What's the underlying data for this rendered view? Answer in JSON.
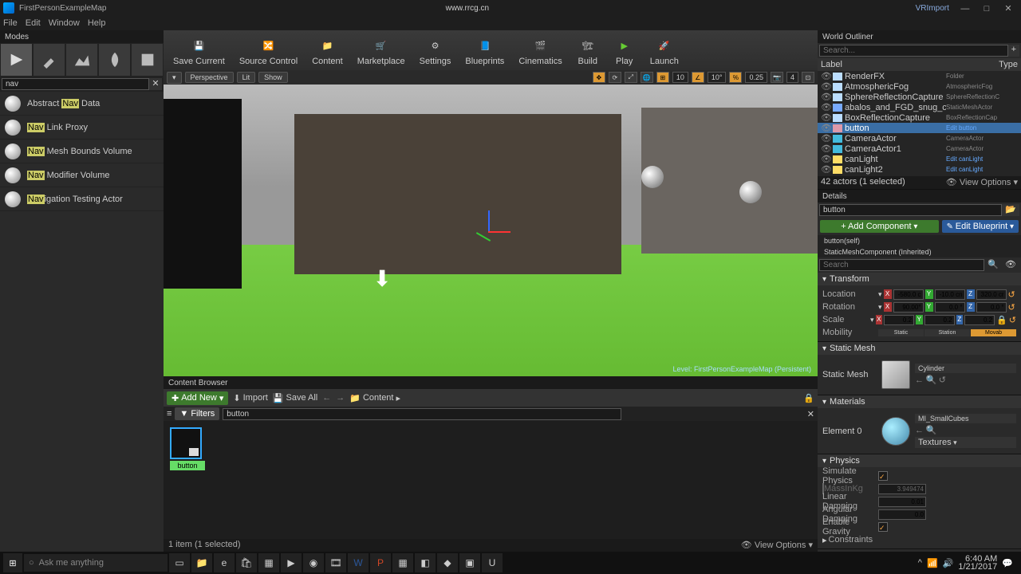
{
  "title": "FirstPersonExampleMap",
  "project": "VRImport",
  "watermark": "www.rrcg.cn",
  "menu": [
    "File",
    "Edit",
    "Window",
    "Help"
  ],
  "modes": {
    "title": "Modes",
    "search": "nav"
  },
  "place_items": [
    {
      "pre": "Abstract ",
      "hl": "Nav",
      "post": " Data"
    },
    {
      "pre": "",
      "hl": "Nav",
      "post": " Link Proxy"
    },
    {
      "pre": "",
      "hl": "Nav",
      "post": " Mesh Bounds Volume"
    },
    {
      "pre": "",
      "hl": "Nav",
      "post": " Modifier Volume"
    },
    {
      "pre": "",
      "hl": "Nav",
      "post": "igation Testing Actor"
    }
  ],
  "toolbar": [
    "Save Current",
    "Source Control",
    "Content",
    "Marketplace",
    "Settings",
    "Blueprints",
    "Cinematics",
    "Build",
    "Play",
    "Launch"
  ],
  "viewport": {
    "persp": "Perspective",
    "lit": "Lit",
    "show": "Show",
    "grid": "10",
    "angle": "10°",
    "scale": "0.25",
    "cam": "4",
    "level": "Level: FirstPersonExampleMap (Persistent)"
  },
  "content_browser": {
    "title": "Content Browser",
    "add": "Add New",
    "import": "Import",
    "save": "Save All",
    "path": "Content",
    "filters": "Filters",
    "filter": "button",
    "item": "button",
    "status": "1 item (1 selected)",
    "view": "View Options"
  },
  "outliner": {
    "title": "World Outliner",
    "search": "Search...",
    "cols": {
      "label": "Label",
      "type": "Type"
    },
    "items": [
      {
        "name": "RenderFX",
        "type": "Folder",
        "icon": "sky"
      },
      {
        "name": "AtmosphericFog",
        "type": "AtmosphericFog",
        "icon": "sky"
      },
      {
        "name": "SphereReflectionCapture",
        "type": "SphereReflectionC",
        "icon": "sky"
      },
      {
        "name": "abalos_and_FGD_snug_chair_ratta",
        "type": "StaticMeshActor",
        "icon": "mesh"
      },
      {
        "name": "BoxReflectionCapture",
        "type": "BoxReflectionCap",
        "icon": "sky"
      },
      {
        "name": "button",
        "type": "Edit button",
        "icon": "bp",
        "selected": true
      },
      {
        "name": "CameraActor",
        "type": "CameraActor",
        "icon": "cam"
      },
      {
        "name": "CameraActor1",
        "type": "CameraActor",
        "icon": "cam"
      },
      {
        "name": "canLight",
        "type": "Edit canLight",
        "icon": "light"
      },
      {
        "name": "canLight2",
        "type": "Edit canLight",
        "icon": "light"
      }
    ],
    "status": "42 actors (1 selected)",
    "view": "View Options"
  },
  "details": {
    "title": "Details",
    "name": "button",
    "add": "+ Add Component",
    "edit": "Edit Blueprint",
    "comps": [
      "button(self)",
      "StaticMeshComponent (Inherited)"
    ],
    "search": "Search",
    "transform": {
      "title": "Transform",
      "loc": {
        "label": "Location",
        "x": "-580.0 c",
        "y": "-10.0 cn",
        "z": "320.0 cr"
      },
      "rot": {
        "label": "Rotation",
        "x": "90.00°",
        "y": "0.0 °",
        "z": "0.0 °"
      },
      "scale": {
        "label": "Scale",
        "x": "0.2",
        "y": "0.2",
        "z": "0.2"
      },
      "mobility": {
        "label": "Mobility",
        "opts": [
          "Static",
          "Station",
          "Movab"
        ]
      }
    },
    "staticmesh": {
      "title": "Static Mesh",
      "label": "Static Mesh",
      "val": "Cylinder"
    },
    "materials": {
      "title": "Materials",
      "label": "Element 0",
      "val": "MI_SmallCubes",
      "tex": "Textures"
    },
    "physics": {
      "title": "Physics",
      "sim": "Simulate Physics",
      "mass": "MassInKg",
      "massval": "3.949474",
      "lin": "Linear Damping",
      "linval": "0.01",
      "ang": "Angular Damping",
      "angval": "0.0",
      "grav": "Enable Gravity",
      "constraints": "Constraints"
    }
  },
  "taskbar": {
    "cortana": "Ask me anything",
    "time": "6:40 AM",
    "date": "1/21/2017"
  }
}
